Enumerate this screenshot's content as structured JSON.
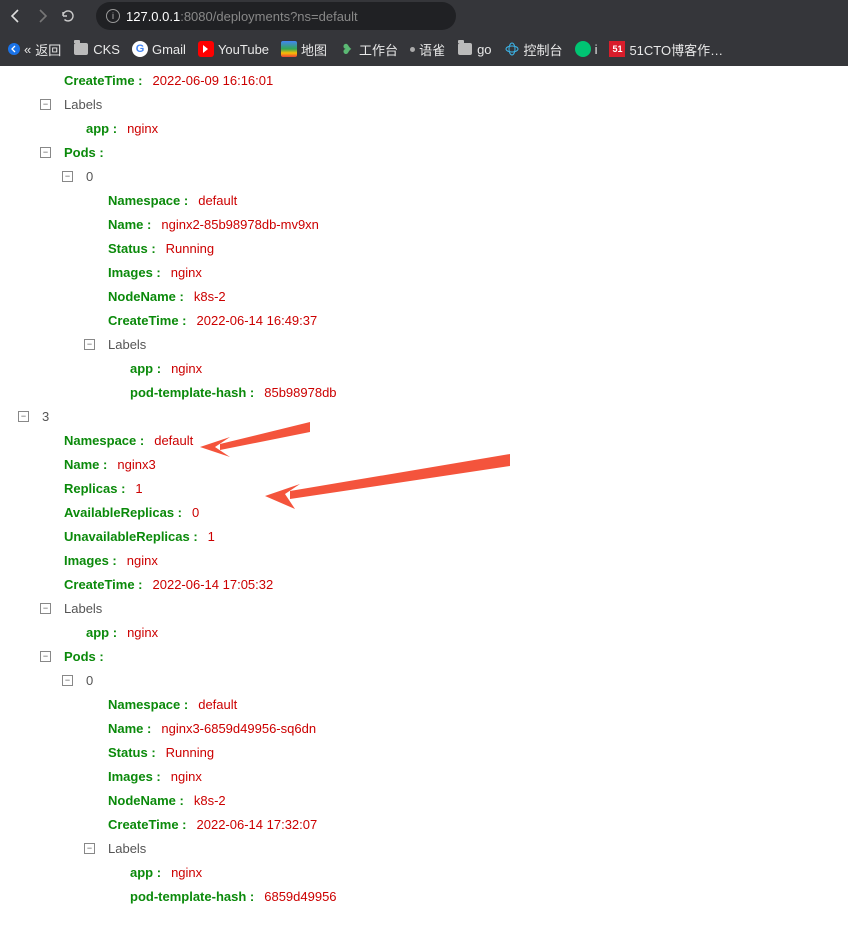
{
  "browser": {
    "url_host": "127.0.0.1",
    "url_path": ":8080/deployments?ns=default"
  },
  "bookmarks": {
    "back": "返回",
    "cks": "CKS",
    "gmail": "Gmail",
    "youtube": "YouTube",
    "maps": "地图",
    "workbench": "工作台",
    "yuque": "语雀",
    "go": "go",
    "console": "控制台",
    "i": "i",
    "cto51": "51CTO博客作…"
  },
  "tree": {
    "top_partial_key": "CreateTime :",
    "top_partial_val": "2022-06-09 16:16:01",
    "labels_label": "Labels",
    "app_key": "app :",
    "app_val": "nginx",
    "pods_key": "Pods :",
    "idx0": "0",
    "pod1": {
      "namespace_k": "Namespace :",
      "namespace_v": "default",
      "name_k": "Name :",
      "name_v": "nginx2-85b98978db-mv9xn",
      "status_k": "Status :",
      "status_v": "Running",
      "images_k": "Images :",
      "images_v": "nginx",
      "nodename_k": "NodeName :",
      "nodename_v": "k8s-2",
      "createtime_k": "CreateTime :",
      "createtime_v": "2022-06-14 16:49:37",
      "labels": "Labels",
      "lbl_app_k": "app :",
      "lbl_app_v": "nginx",
      "lbl_hash_k": "pod-template-hash :",
      "lbl_hash_v": "85b98978db"
    },
    "idx3": "3",
    "dep3": {
      "namespace_k": "Namespace :",
      "namespace_v": "default",
      "name_k": "Name :",
      "name_v": "nginx3",
      "replicas_k": "Replicas :",
      "replicas_v": "1",
      "avail_k": "AvailableReplicas :",
      "avail_v": "0",
      "unavail_k": "UnavailableReplicas :",
      "unavail_v": "1",
      "images_k": "Images :",
      "images_v": "nginx",
      "createtime_k": "CreateTime :",
      "createtime_v": "2022-06-14 17:05:32",
      "labels": "Labels",
      "lbl_app_k": "app :",
      "lbl_app_v": "nginx",
      "pods_k": "Pods :",
      "idx0": "0",
      "pod": {
        "namespace_k": "Namespace :",
        "namespace_v": "default",
        "name_k": "Name :",
        "name_v": "nginx3-6859d49956-sq6dn",
        "status_k": "Status :",
        "status_v": "Running",
        "images_k": "Images :",
        "images_v": "nginx",
        "nodename_k": "NodeName :",
        "nodename_v": "k8s-2",
        "createtime_k": "CreateTime :",
        "createtime_v": "2022-06-14 17:32:07",
        "labels": "Labels",
        "lbl_app_k": "app :",
        "lbl_app_v": "nginx",
        "lbl_hash_k": "pod-template-hash :",
        "lbl_hash_v": "6859d49956"
      }
    }
  }
}
